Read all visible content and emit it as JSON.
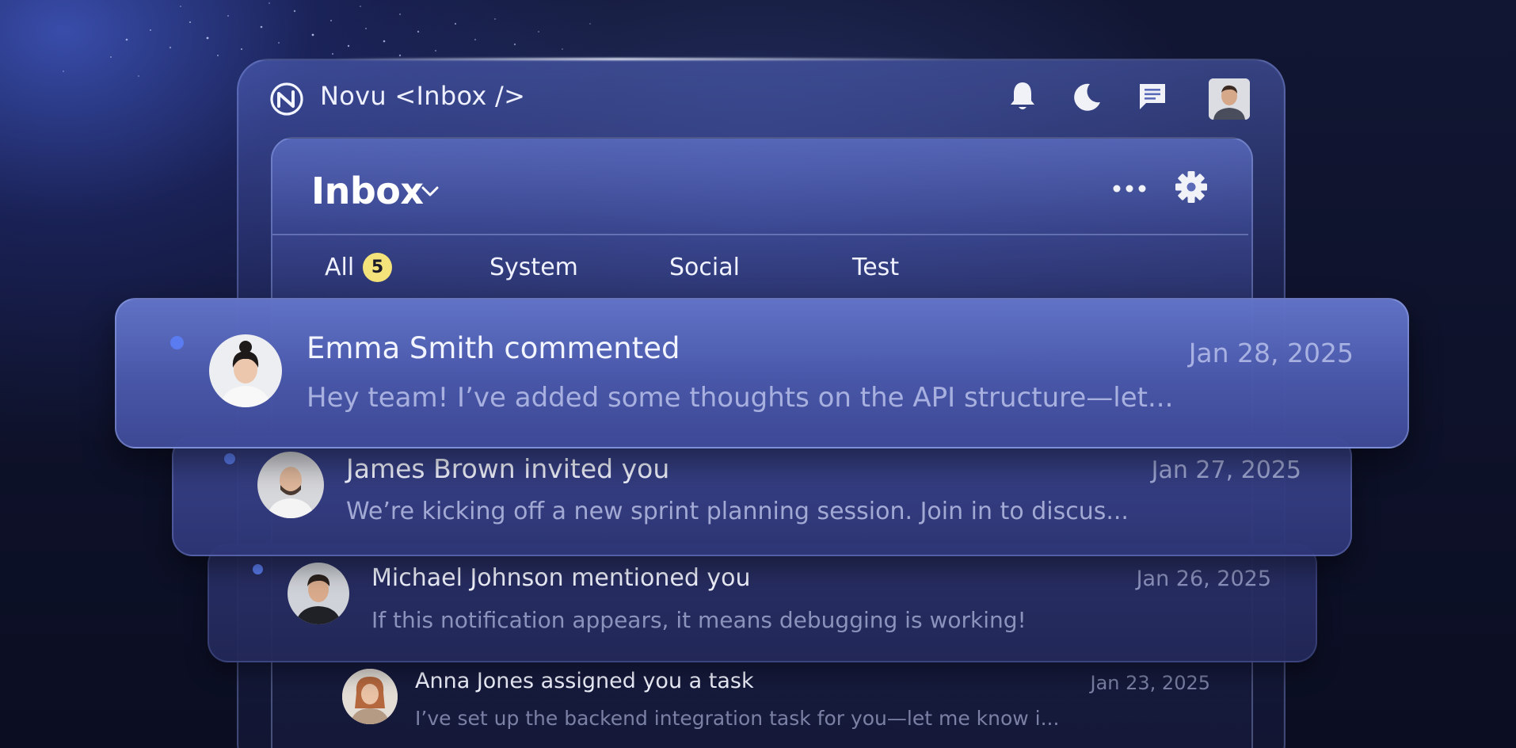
{
  "app": {
    "title": "Novu <Inbox />"
  },
  "topbar": {
    "icons": [
      "bell-icon",
      "moon-icon",
      "chat-icon"
    ]
  },
  "inbox": {
    "title": "Inbox",
    "tabs": [
      {
        "label": "All",
        "badge": "5"
      },
      {
        "label": "System"
      },
      {
        "label": "Social"
      },
      {
        "label": "Test"
      }
    ]
  },
  "notifications": [
    {
      "title": "Emma Smith commented",
      "body": "Hey team! I’ve added some thoughts on the API structure—let...",
      "date": "Jan 28, 2025",
      "unread": true
    },
    {
      "title": "James Brown invited you",
      "body": "We’re kicking off a new sprint planning session. Join in to discus...",
      "date": "Jan 27, 2025",
      "unread": true
    },
    {
      "title": "Michael Johnson mentioned you",
      "body": "If this notification appears, it means debugging is working!",
      "date": "Jan 26, 2025",
      "unread": true
    },
    {
      "title": "Anna Jones assigned you a task",
      "body": "I’ve set up the backend integration task for you—let me know i...",
      "date": "Jan 23, 2025",
      "unread": false
    }
  ],
  "colors": {
    "unread_dot": "#5a7cf0",
    "badge": "#f4e37a",
    "background": "#0c0f24"
  }
}
